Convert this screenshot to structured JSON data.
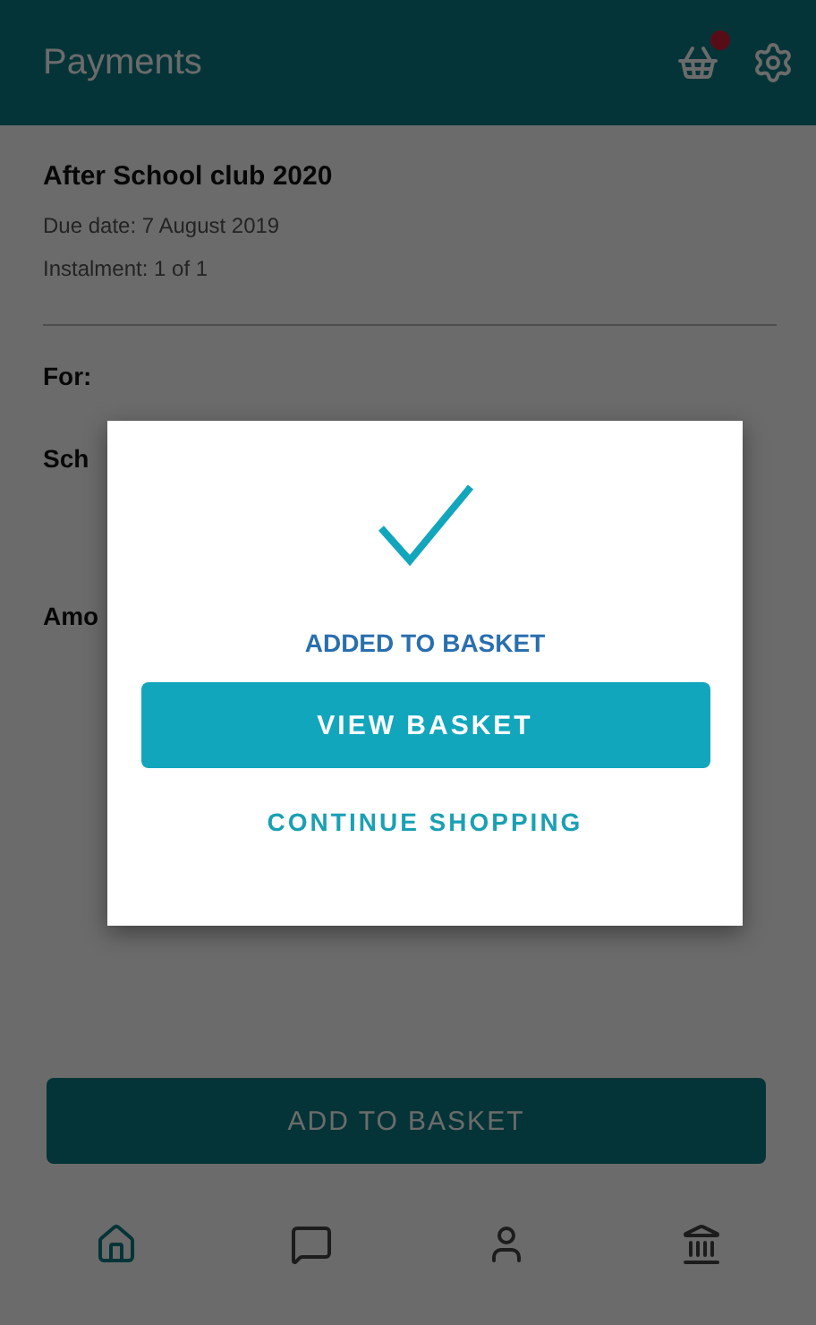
{
  "header": {
    "title": "Payments"
  },
  "item": {
    "title": "After School club 2020",
    "due_date": "Due date:  7 August 2019",
    "instalment": "Instalment:  1 of 1"
  },
  "fields": [
    {
      "label": "For:"
    },
    {
      "label": "Sch"
    },
    {
      "label": "Amo"
    }
  ],
  "dialog": {
    "message": "ADDED TO BASKET",
    "primary": "VIEW BASKET",
    "secondary": "CONTINUE SHOPPING"
  },
  "add_button": "ADD TO BASKET",
  "nav": [
    {
      "kind": "home",
      "selected": true
    },
    {
      "kind": "chat",
      "selected": false
    },
    {
      "kind": "profile",
      "selected": false
    },
    {
      "kind": "bank",
      "selected": false
    }
  ]
}
